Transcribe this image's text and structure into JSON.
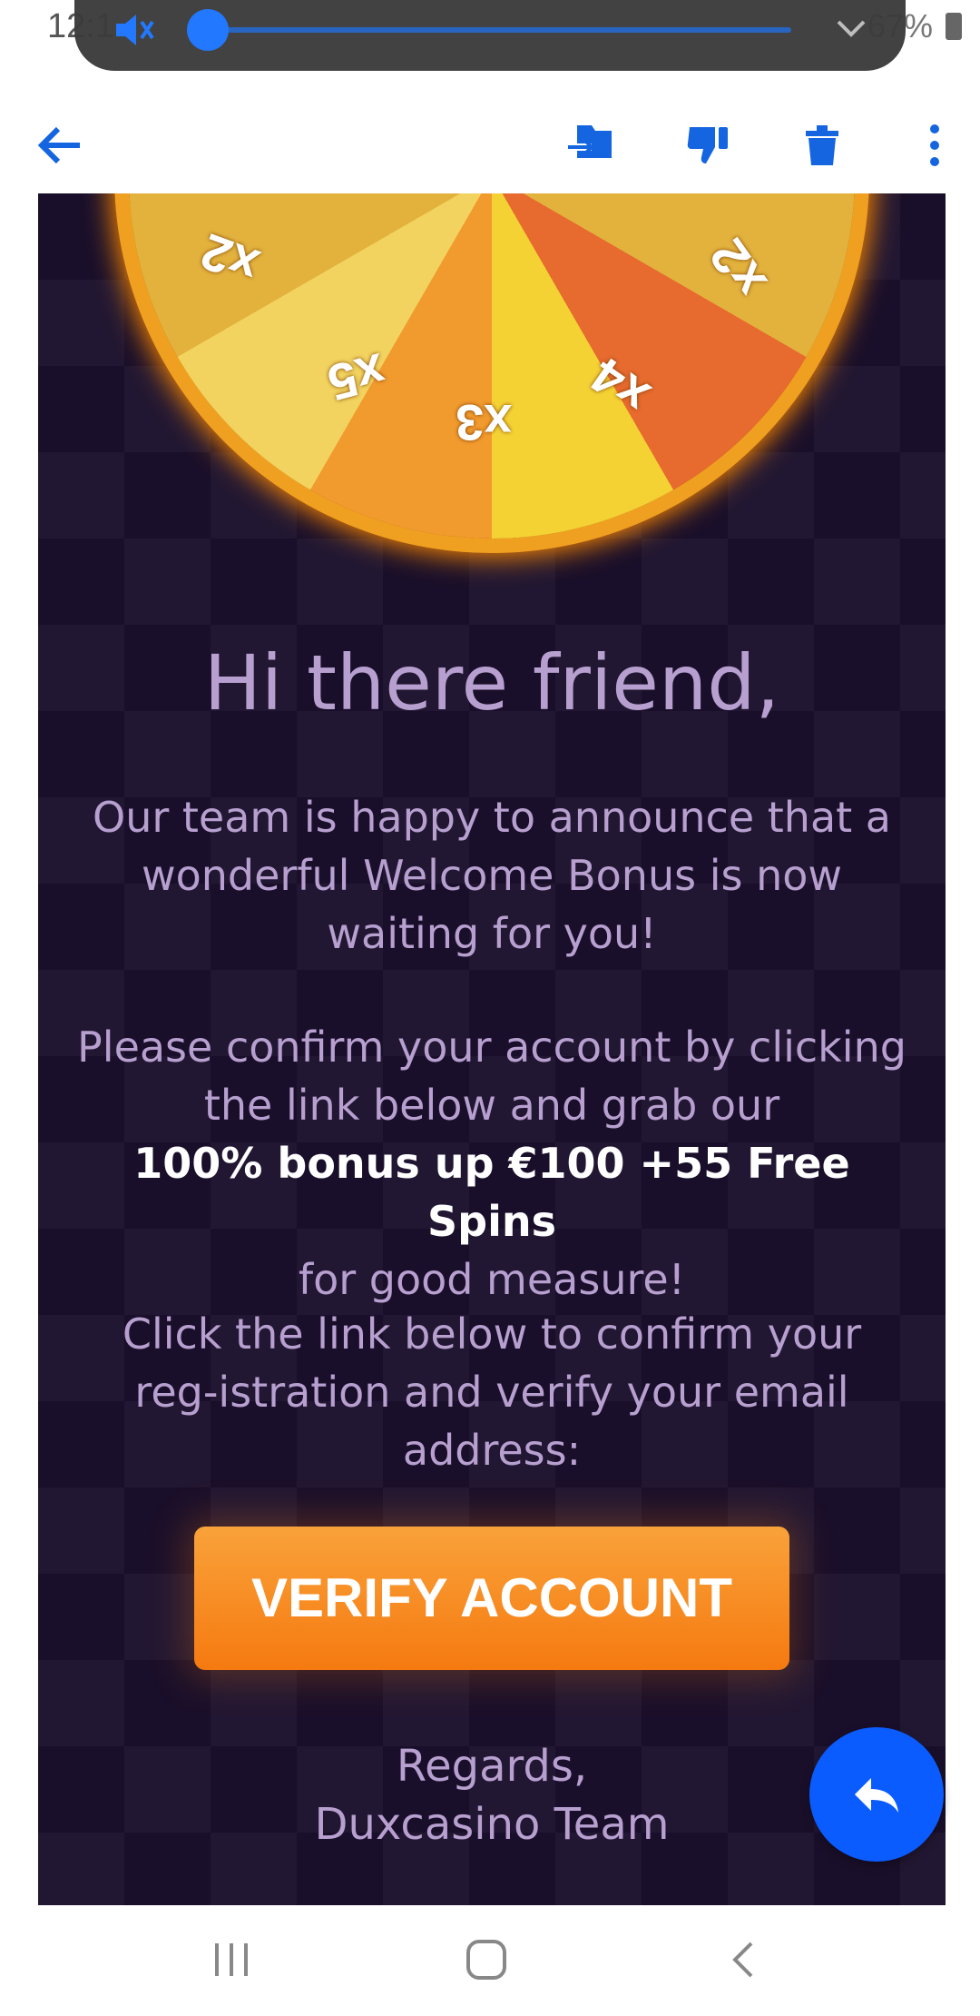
{
  "status_bar": {
    "time": "12:1",
    "battery": "67%"
  },
  "toolbar": {
    "back_icon": "arrow-left-icon",
    "move_icon": "move-to-folder-icon",
    "spam_icon": "thumbs-down-icon",
    "delete_icon": "trash-icon",
    "more_icon": "more-vertical-icon"
  },
  "email": {
    "wheel_labels": [
      "x2",
      "x5",
      "x3",
      "x4",
      "x2"
    ],
    "greeting": "Hi there friend,",
    "para1": "Our team is happy to announce that a wonderful Welcome Bonus is now waiting for you!",
    "para2_before": "Please confirm your account by clicking the link below and grab our",
    "para2_bold": "100% bonus up €100 +55 Free Spins",
    "para2_after": "for good measure!",
    "para3": "Click the link below to confirm your reg-istration and verify your email address:",
    "verify_button": "VERIFY ACCOUNT",
    "regards_line1": "Regards,",
    "regards_line2": "Duxcasino Team"
  },
  "fab": {
    "icon": "reply-icon"
  },
  "navbar": {
    "recents_icon": "recents-icon",
    "home_icon": "home-icon",
    "back_icon": "back-chevron-icon"
  },
  "colors": {
    "accent": "#0a5cff",
    "toolbar_icon": "#1565e0",
    "email_bg": "#1a0f2a",
    "body_text": "#b7a0cf",
    "button": "#f7891f"
  }
}
